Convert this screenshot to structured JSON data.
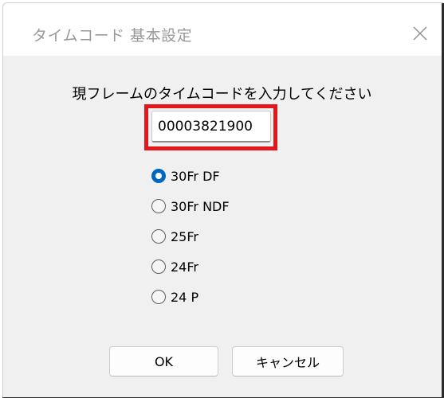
{
  "window": {
    "title": "タイムコード 基本設定",
    "close_icon": "close-icon"
  },
  "prompt": "現フレームのタイムコードを入力してください",
  "timecode_input": {
    "value": "00003821900"
  },
  "frame_rate_options": [
    {
      "label": "30Fr DF",
      "checked": true
    },
    {
      "label": "30Fr NDF",
      "checked": false
    },
    {
      "label": "25Fr",
      "checked": false
    },
    {
      "label": "24Fr",
      "checked": false
    },
    {
      "label": "24 P",
      "checked": false
    }
  ],
  "buttons": {
    "ok_label": "OK",
    "cancel_label": "キャンセル"
  },
  "colors": {
    "highlight": "#e3171b",
    "radio_accent": "#0067c0"
  }
}
